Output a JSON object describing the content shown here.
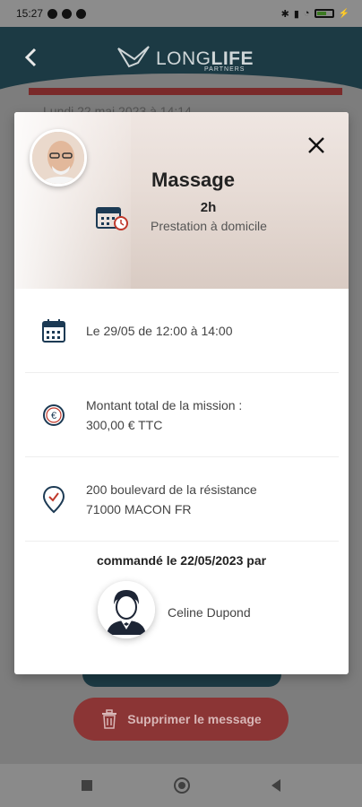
{
  "status_bar": {
    "time": "15:27"
  },
  "header": {
    "logo_long": "LONG",
    "logo_life": "LIFE",
    "logo_sub": "PARTNERS"
  },
  "background": {
    "date_text": "Lundi 22 mai 2023 à 14:14"
  },
  "modal": {
    "title": "Massage",
    "duration": "2h",
    "service_type": "Prestation à domicile",
    "schedule": "Le 29/05 de 12:00 à 14:00",
    "amount_label": "Montant total de la mission :",
    "amount_value": "300,00 € TTC",
    "address_line1": "200 boulevard de la résistance",
    "address_line2": "71000 MACON FR",
    "ordered_by": "commandé le 22/05/2023 par",
    "user_name": "Celine Dupond"
  },
  "actions": {
    "delete_label": "Supprimer le message"
  },
  "icons": {
    "back": "chevron-left-icon",
    "close": "close-icon",
    "calendar": "calendar-icon",
    "euro": "euro-icon",
    "location": "location-pin-icon",
    "trash": "trash-icon"
  },
  "colors": {
    "header": "#1c3a44",
    "delete_button": "#8b3535",
    "icon_blue": "#1c3a54",
    "icon_red": "#c0392b"
  }
}
